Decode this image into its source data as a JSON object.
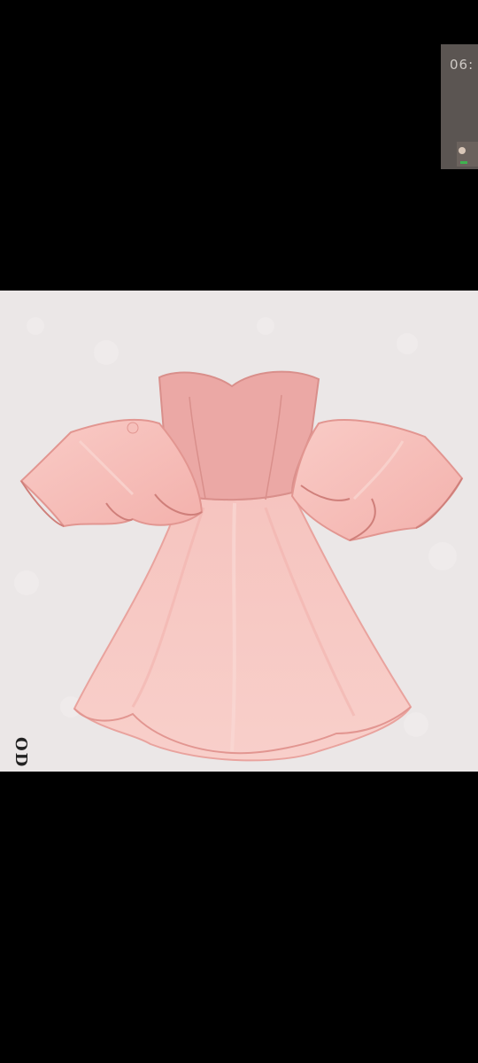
{
  "pip_window": {
    "time": "06:"
  },
  "photo": {
    "subject_icon": "pink-off-shoulder-ruffle-dress",
    "edge_text": "OD"
  },
  "colors": {
    "background": "#000000",
    "photo_backdrop": "#ebe7e7",
    "dress_pink": "#f2b8b3",
    "bodice_pink": "#eaa9a6",
    "pip_background": "#5b5552"
  }
}
